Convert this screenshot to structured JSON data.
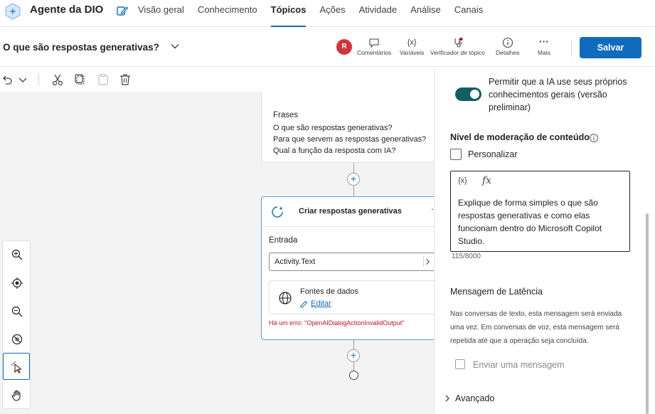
{
  "app": {
    "title": "Agente da DIO",
    "tabs": [
      {
        "label": "Visão geral"
      },
      {
        "label": "Conhecimento"
      },
      {
        "label": "Tópicos"
      },
      {
        "label": "Ações"
      },
      {
        "label": "Atividade"
      },
      {
        "label": "Análise"
      },
      {
        "label": "Canais"
      }
    ],
    "active_tab": "Tópicos"
  },
  "header": {
    "topic_title": "O que são respostas generativas?",
    "avatar_initial": "R",
    "buttons": [
      {
        "label": "Comentários",
        "icon": "comment-icon"
      },
      {
        "label": "Variáveis",
        "icon": "variable-icon"
      },
      {
        "label": "Verificador de tópico",
        "icon": "stethoscope-icon"
      },
      {
        "label": "Detalhes",
        "icon": "info-icon"
      },
      {
        "label": "Mais",
        "icon": "more-icon"
      }
    ],
    "save_label": "Salvar"
  },
  "canvas": {
    "trigger": {
      "frases_label": "Frases",
      "frases": [
        "O que são respostas generativas?",
        "Para que servem as respostas generativas?",
        "Qual a função da resposta com IA?"
      ]
    },
    "generative_node": {
      "title": "Criar respostas generativas",
      "entrada_label": "Entrada",
      "entrada_value": "Activity.Text",
      "fontes_label": "Fontes de dados",
      "editar_label": "Editar",
      "error": "Há um erro: \"OpenAIDialogActionInvalidOutput\""
    }
  },
  "panel": {
    "toggle_text": "Permitir que a IA use seus próprios conhecimentos gerais (versão preliminar)",
    "toggle_on": true,
    "moderation_title": "Nível de moderação de conteúdo",
    "personalizar_label": "Personalizar",
    "prompt_var_label": "{x}",
    "prompt_fx_label": "fx",
    "prompt_text": "Explique de forma simples o que são respostas generativas e como elas funcionam dentro do Microsoft Copilot Studio.",
    "char_count": "115/8000",
    "latency_title": "Mensagem de Latência",
    "latency_desc": "Nas conversas de texto, esta mensagem será enviada uma vez. Em conversas de voz, esta mensagem será repetida até que a operação seja concluída.",
    "send_message_label": "Enviar uma mensagem",
    "advanced_label": "Avançado"
  },
  "colors": {
    "accent": "#0f6cbd",
    "toggle": "#115e67",
    "error": "#c50f1f",
    "avatar": "#d13438"
  }
}
